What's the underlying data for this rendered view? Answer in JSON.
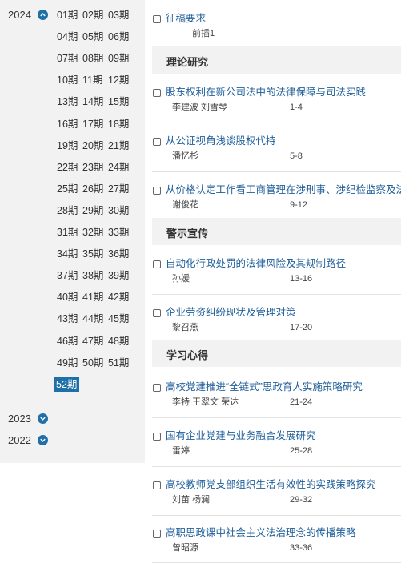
{
  "years": [
    {
      "label": "2024",
      "expanded": true,
      "issues": [
        "01期",
        "02期",
        "03期",
        "04期",
        "05期",
        "06期",
        "07期",
        "08期",
        "09期",
        "10期",
        "11期",
        "12期",
        "13期",
        "14期",
        "15期",
        "16期",
        "17期",
        "18期",
        "19期",
        "20期",
        "21期",
        "22期",
        "23期",
        "24期",
        "25期",
        "26期",
        "27期",
        "28期",
        "29期",
        "30期",
        "31期",
        "32期",
        "33期",
        "34期",
        "35期",
        "36期",
        "37期",
        "38期",
        "39期",
        "40期",
        "41期",
        "42期",
        "43期",
        "44期",
        "45期",
        "46期",
        "47期",
        "48期",
        "49期",
        "50期",
        "51期",
        "52期"
      ],
      "selected_issue": "52期"
    },
    {
      "label": "2023",
      "expanded": false
    },
    {
      "label": "2022",
      "expanded": false
    }
  ],
  "articles_top": [
    {
      "title": "征稿要求",
      "authors": "",
      "pages": "前插1"
    }
  ],
  "sections": [
    {
      "name": "理论研究",
      "articles": [
        {
          "title": "股东权利在新公司法中的法律保障与司法实践",
          "authors": "李建波 刘雪琴",
          "pages": "1-4"
        },
        {
          "title": "从公证视角浅谈股权代持",
          "authors": "潘忆杉",
          "pages": "5-8"
        },
        {
          "title": "从价格认定工作看工商管理在涉刑事、涉纪检监察及法",
          "authors": "谢俊花",
          "pages": "9-12"
        }
      ]
    },
    {
      "name": "警示宣传",
      "articles": [
        {
          "title": "自动化行政处罚的法律风险及其规制路径",
          "authors": "孙媛",
          "pages": "13-16"
        },
        {
          "title": "企业劳资纠纷现状及管理对策",
          "authors": "黎召燕",
          "pages": "17-20"
        }
      ]
    },
    {
      "name": "学习心得",
      "articles": [
        {
          "title": "高校党建推进“全链式”思政育人实施策略研究",
          "authors": "李特 王翠文 荣达",
          "pages": "21-24"
        },
        {
          "title": "国有企业党建与业务融合发展研究",
          "authors": "雷婷",
          "pages": "25-28"
        },
        {
          "title": "高校教师党支部组织生活有效性的实践策略探究",
          "authors": "刘苗 杨澜",
          "pages": "29-32"
        },
        {
          "title": "高职思政课中社会主义法治理念的传播策略",
          "authors": "曾昭源",
          "pages": "33-36"
        }
      ]
    }
  ],
  "colors": {
    "accent": "#1f6fa8",
    "link": "#1f5f9a",
    "panel": "#f2f2f2"
  }
}
